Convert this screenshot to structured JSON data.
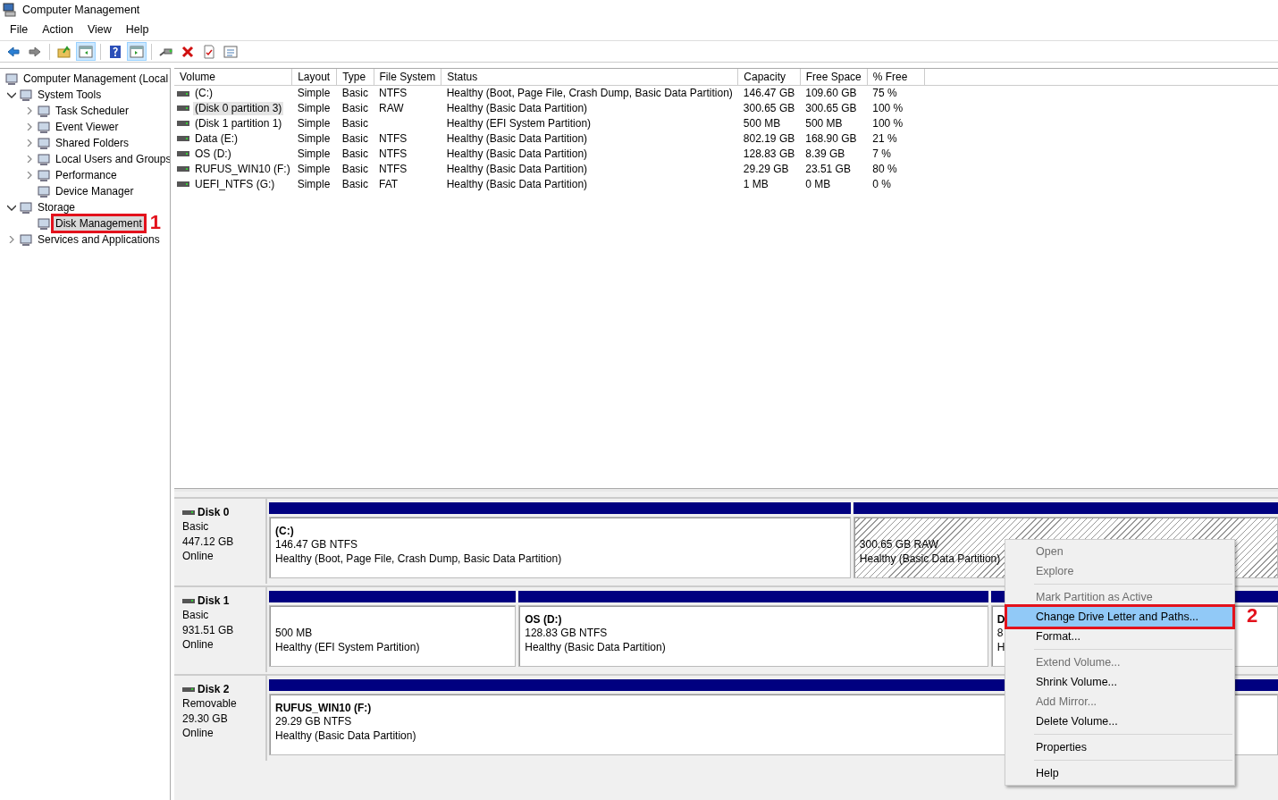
{
  "window": {
    "title": "Computer Management"
  },
  "menu_bar": [
    "File",
    "Action",
    "View",
    "Help"
  ],
  "toolbar": [
    {
      "kind": "back",
      "pressed": false
    },
    {
      "kind": "forward",
      "pressed": false
    },
    {
      "kind": "separator"
    },
    {
      "kind": "up",
      "pressed": false
    },
    {
      "kind": "tree-pane",
      "pressed": true
    },
    {
      "kind": "separator"
    },
    {
      "kind": "help",
      "pressed": false
    },
    {
      "kind": "action-pane",
      "pressed": true
    },
    {
      "kind": "separator"
    },
    {
      "kind": "connect",
      "pressed": false
    },
    {
      "kind": "delete",
      "pressed": false
    },
    {
      "kind": "properties",
      "pressed": false
    },
    {
      "kind": "list",
      "pressed": false
    }
  ],
  "tree": [
    {
      "label": "Computer Management (Local",
      "selected": false,
      "children": [
        {
          "label": "System Tools",
          "expanded": true,
          "selected": false,
          "children": [
            {
              "label": "Task Scheduler",
              "expanded": false,
              "selected": false
            },
            {
              "label": "Event Viewer",
              "expanded": false,
              "selected": false
            },
            {
              "label": "Shared Folders",
              "expanded": false,
              "selected": false
            },
            {
              "label": "Local Users and Groups",
              "expanded": false,
              "selected": false
            },
            {
              "label": "Performance",
              "expanded": false,
              "selected": false
            },
            {
              "label": "Device Manager",
              "selected": false
            }
          ]
        },
        {
          "label": "Storage",
          "expanded": true,
          "selected": false,
          "children": [
            {
              "label": "Disk Management",
              "selected": true,
              "callout": "1"
            }
          ]
        },
        {
          "label": "Services and Applications",
          "expanded": false,
          "selected": false
        }
      ]
    }
  ],
  "table": {
    "columns": [
      "Volume",
      "Layout",
      "Type",
      "File System",
      "Status",
      "Capacity",
      "Free Space",
      "% Free"
    ],
    "rows": [
      {
        "selected": false,
        "cells": [
          "(C:)",
          "Simple",
          "Basic",
          "NTFS",
          "Healthy (Boot, Page File, Crash Dump, Basic Data Partition)",
          "146.47 GB",
          "109.60 GB",
          "75 %"
        ]
      },
      {
        "selected": true,
        "cells": [
          "(Disk 0 partition 3)",
          "Simple",
          "Basic",
          "RAW",
          "Healthy (Basic Data Partition)",
          "300.65 GB",
          "300.65 GB",
          "100 %"
        ]
      },
      {
        "selected": false,
        "cells": [
          "(Disk 1 partition 1)",
          "Simple",
          "Basic",
          "",
          "Healthy (EFI System Partition)",
          "500 MB",
          "500 MB",
          "100 %"
        ]
      },
      {
        "selected": false,
        "cells": [
          "Data (E:)",
          "Simple",
          "Basic",
          "NTFS",
          "Healthy (Basic Data Partition)",
          "802.19 GB",
          "168.90 GB",
          "21 %"
        ]
      },
      {
        "selected": false,
        "cells": [
          "OS (D:)",
          "Simple",
          "Basic",
          "NTFS",
          "Healthy (Basic Data Partition)",
          "128.83 GB",
          "8.39 GB",
          "7 %"
        ]
      },
      {
        "selected": false,
        "cells": [
          "RUFUS_WIN10 (F:)",
          "Simple",
          "Basic",
          "NTFS",
          "Healthy (Basic Data Partition)",
          "29.29 GB",
          "23.51 GB",
          "80 %"
        ]
      },
      {
        "selected": false,
        "cells": [
          "UEFI_NTFS (G:)",
          "Simple",
          "Basic",
          "FAT",
          "Healthy (Basic Data Partition)",
          "1 MB",
          "0 MB",
          "0 %"
        ]
      }
    ]
  },
  "disks": [
    {
      "name": "Disk 0",
      "type": "Basic",
      "size": "447.12 GB",
      "state": "Online",
      "partitions": [
        {
          "label": "(C:)",
          "size": "146.47 GB NTFS",
          "status": "Healthy (Boot, Page File, Crash Dump, Basic Data Partition)",
          "hatched": false
        },
        {
          "size": "300.65 GB RAW",
          "status": "Healthy (Basic Data Partition)",
          "hatched": true
        }
      ]
    },
    {
      "name": "Disk 1",
      "type": "Basic",
      "size": "931.51 GB",
      "state": "Online",
      "partitions": [
        {
          "size": "500 MB",
          "status": "Healthy (EFI System Partition)",
          "hatched": false
        },
        {
          "label": "OS  (D:)",
          "size": "128.83 GB NTFS",
          "status": "Healthy (Basic Data Partition)",
          "hatched": false
        },
        {
          "label": "D",
          "size": "8",
          "status": "H",
          "hatched": false
        }
      ]
    },
    {
      "name": "Disk 2",
      "type": "Removable",
      "size": "29.30 GB",
      "state": "Online",
      "partitions": [
        {
          "label": "RUFUS_WIN10  (F:)",
          "size": "29.29 GB NTFS",
          "status": "Healthy (Basic Data Partition)",
          "hatched": false
        }
      ]
    }
  ],
  "context_menu": [
    {
      "kind": "item",
      "label": "Open",
      "disabled": true,
      "selected": false
    },
    {
      "kind": "item",
      "label": "Explore",
      "disabled": true,
      "selected": false
    },
    {
      "kind": "separator"
    },
    {
      "kind": "item",
      "label": "Mark Partition as Active",
      "disabled": true,
      "selected": false
    },
    {
      "kind": "item",
      "label": "Change Drive Letter and Paths...",
      "disabled": false,
      "selected": true,
      "callout": "2"
    },
    {
      "kind": "item",
      "label": "Format...",
      "disabled": false,
      "selected": false
    },
    {
      "kind": "separator"
    },
    {
      "kind": "item",
      "label": "Extend Volume...",
      "disabled": true,
      "selected": false
    },
    {
      "kind": "item",
      "label": "Shrink Volume...",
      "disabled": false,
      "selected": false
    },
    {
      "kind": "item",
      "label": "Add Mirror...",
      "disabled": true,
      "selected": false
    },
    {
      "kind": "item",
      "label": "Delete Volume...",
      "disabled": false,
      "selected": false
    },
    {
      "kind": "separator"
    },
    {
      "kind": "item",
      "label": "Properties",
      "disabled": false,
      "selected": false
    },
    {
      "kind": "separator"
    },
    {
      "kind": "item",
      "label": "Help",
      "disabled": false,
      "selected": false
    }
  ]
}
